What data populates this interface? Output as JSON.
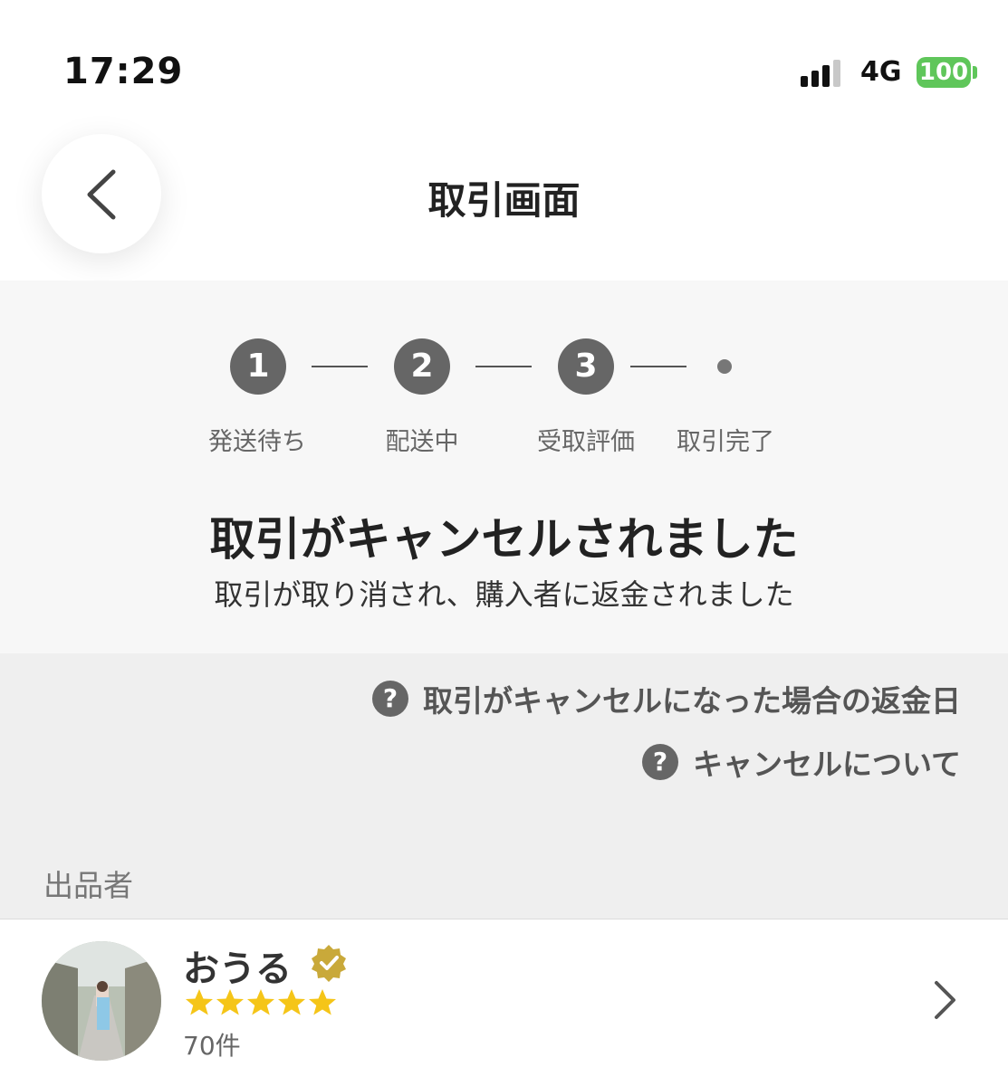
{
  "status_bar": {
    "time": "17:29",
    "network": "4G",
    "battery": "100",
    "signal_bars": 3,
    "signal_bars_total": 4
  },
  "header": {
    "title": "取引画面",
    "back_icon": "chevron-left-icon"
  },
  "progress": {
    "steps": [
      {
        "number": "1",
        "label": "発送待ち"
      },
      {
        "number": "2",
        "label": "配送中"
      },
      {
        "number": "3",
        "label": "受取評価"
      },
      {
        "number": "",
        "label": "取引完了"
      }
    ],
    "title": "取引がキャンセルされました",
    "subtitle": "取引が取り消され、購入者に返金されました"
  },
  "help_links": [
    {
      "icon": "question-circle-icon",
      "text": "取引がキャンセルになった場合の返金日"
    },
    {
      "icon": "question-circle-icon",
      "text": "キャンセルについて"
    }
  ],
  "seller": {
    "section_label": "出品者",
    "name": "おうる",
    "verified_icon": "verified-badge-icon",
    "rating": 5,
    "rating_max": 5,
    "review_count": "70件",
    "chevron_icon": "chevron-right-icon"
  },
  "colors": {
    "step_active": "#666666",
    "verified_gold": "#c9a93a",
    "star_yellow": "#f5c518",
    "battery_green": "#5fc65a",
    "section_bg": "#f7f7f7"
  }
}
